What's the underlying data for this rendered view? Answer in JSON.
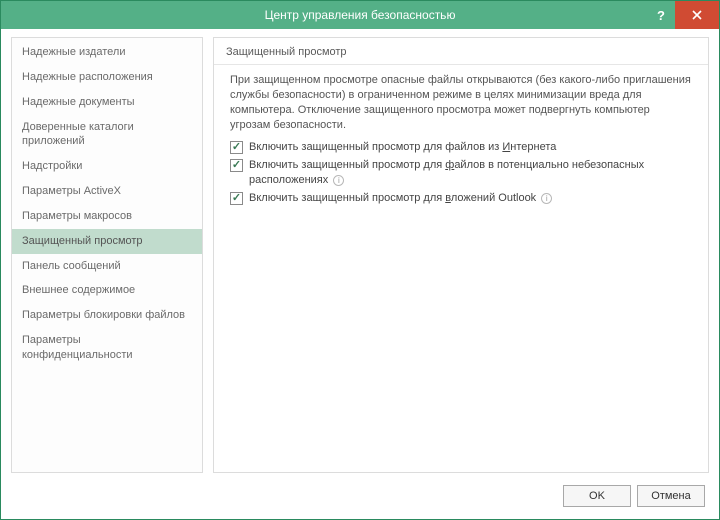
{
  "window": {
    "title": "Центр управления безопасностью"
  },
  "sidebar": {
    "items": [
      {
        "label": "Надежные издатели"
      },
      {
        "label": "Надежные расположения"
      },
      {
        "label": "Надежные документы"
      },
      {
        "label": "Доверенные каталоги приложений"
      },
      {
        "label": "Надстройки"
      },
      {
        "label": "Параметры ActiveX"
      },
      {
        "label": "Параметры макросов"
      },
      {
        "label": "Защищенный просмотр",
        "selected": true
      },
      {
        "label": "Панель сообщений"
      },
      {
        "label": "Внешнее содержимое"
      },
      {
        "label": "Параметры блокировки файлов"
      },
      {
        "label": "Параметры конфиденциальности"
      }
    ]
  },
  "content": {
    "section_title": "Защищенный просмотр",
    "description": "При защищенном просмотре опасные файлы открываются (без какого-либо приглашения службы безопасности) в ограниченном режиме в целях минимизации вреда для компьютера. Отключение защищенного просмотра может подвергнуть компьютер угрозам безопасности.",
    "options": [
      {
        "label_pre": "Включить защищенный просмотр для файлов из ",
        "label_u": "И",
        "label_post": "нтернета",
        "checked": true,
        "info": false
      },
      {
        "label_pre": "Включить защищенный просмотр для ",
        "label_u": "ф",
        "label_post": "айлов в потенциально небезопасных расположениях",
        "checked": true,
        "info": true
      },
      {
        "label_pre": "Включить защищенный просмотр для ",
        "label_u": "в",
        "label_post": "ложений Outlook",
        "checked": true,
        "info": true
      }
    ]
  },
  "footer": {
    "ok": "OK",
    "cancel": "Отмена"
  }
}
